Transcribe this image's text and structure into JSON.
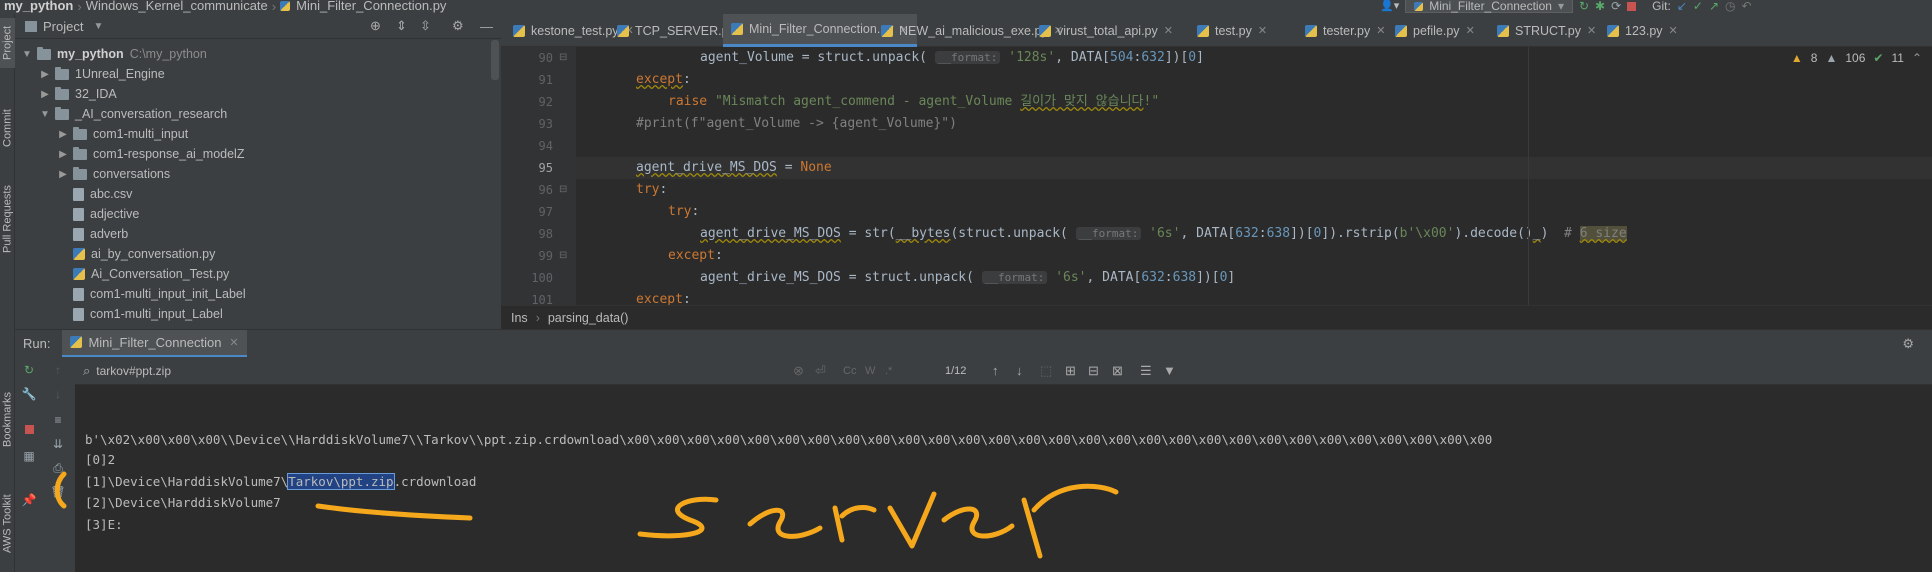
{
  "breadcrumb": {
    "project": "my_python",
    "folder": "Windows_Kernel_communicate",
    "file": "Mini_Filter_Connection.py"
  },
  "toolbar": {
    "run_config": "Mini_Filter_Connection",
    "git_label": "Git:"
  },
  "left_strip": [
    "Project",
    "Commit",
    "Pull Requests",
    "Bookmarks",
    "AWS Toolkit"
  ],
  "project_panel": {
    "title": "Project",
    "root_name": "my_python",
    "root_path": "C:\\my_python",
    "items": [
      {
        "label": "1Unreal_Engine",
        "type": "folder",
        "level": 1,
        "expanded": false
      },
      {
        "label": "32_IDA",
        "type": "folder",
        "level": 1,
        "expanded": false
      },
      {
        "label": "_AI_conversation_research",
        "type": "folder",
        "level": 1,
        "expanded": true
      },
      {
        "label": "com1-multi_input",
        "type": "folder",
        "level": 2,
        "expanded": false
      },
      {
        "label": "com1-response_ai_modelZ",
        "type": "folder",
        "level": 2,
        "expanded": false
      },
      {
        "label": "conversations",
        "type": "folder",
        "level": 2,
        "expanded": false
      },
      {
        "label": "abc.csv",
        "type": "file",
        "level": 2
      },
      {
        "label": "adjective",
        "type": "file",
        "level": 2
      },
      {
        "label": "adverb",
        "type": "file",
        "level": 2
      },
      {
        "label": "ai_by_conversation.py",
        "type": "py",
        "level": 2
      },
      {
        "label": "Ai_Conversation_Test.py",
        "type": "py",
        "level": 2
      },
      {
        "label": "com1-multi_input_init_Label",
        "type": "file",
        "level": 2
      },
      {
        "label": "com1-multi_input_Label",
        "type": "file",
        "level": 2
      }
    ]
  },
  "editor_tabs": [
    {
      "label": "kestone_test.py",
      "active": false
    },
    {
      "label": "TCP_SERVER.py",
      "active": false
    },
    {
      "label": "Mini_Filter_Connection.py",
      "active": true
    },
    {
      "label": "NEW_ai_malicious_exe.py",
      "active": false
    },
    {
      "label": "virust_total_api.py",
      "active": false
    },
    {
      "label": "test.py",
      "active": false
    },
    {
      "label": "tester.py",
      "active": false
    },
    {
      "label": "pefile.py",
      "active": false
    },
    {
      "label": "STRUCT.py",
      "active": false
    },
    {
      "label": "123.py",
      "active": false
    }
  ],
  "inspections": {
    "warnings": "8",
    "weak": "106",
    "ok": "11"
  },
  "line_numbers": [
    "90",
    "91",
    "92",
    "93",
    "94",
    "95",
    "96",
    "97",
    "98",
    "99",
    "100",
    "101"
  ],
  "code_lines": [
    "agent_Volume = struct.unpack( __format: '128s', DATA[504:632])[0]",
    "except:",
    "raise \"Mismatch agent_commend - agent_Volume 길이가 맞지 않습니다!\"",
    "#print(f\"agent_Volume -> {agent_Volume}\")",
    "",
    "agent_drive_MS_DOS = None",
    "try:",
    "try:",
    "agent_drive_MS_DOS = str(__bytes(struct.unpack( __format: '6s', DATA[632:638])[0]).rstrip(b'\\x00').decode()_)  # 6 size",
    "except:",
    "agent_drive_MS_DOS = struct.unpack( __format: '6s', DATA[632:638])[0]",
    "except:"
  ],
  "editor_breadcrumb": {
    "a": "Ins",
    "b": "parsing_data()"
  },
  "run_panel": {
    "label": "Run:",
    "tab": "Mini_Filter_Connection",
    "search_value": "tarkov#ppt.zip",
    "match_count": "1/12"
  },
  "console": {
    "line1": "b'\\x02\\x00\\x00\\x00\\\\Device\\\\HarddiskVolume7\\\\Tarkov\\\\ppt.zip.crdownload\\x00\\x00\\x00\\x00\\x00\\x00\\x00\\x00\\x00\\x00\\x00\\x00\\x00\\x00\\x00\\x00\\x00\\x00\\x00\\x00\\x00\\x00\\x00\\x00\\x00\\x00\\x00\\x00\\x00",
    "line2": "[0]2",
    "line3_pre": "[1]\\Device\\HarddiskVolume7\\",
    "line3_sel": "Tarkov\\ppt.zip",
    "line3_post": ".crdownload",
    "line4": "[2]\\Device\\HarddiskVolume7",
    "line5": "[3]E:"
  },
  "annotation": {
    "text": "server",
    "color": "#f5a81c"
  },
  "colors": {
    "accent": "#4a88c7",
    "selection": "#214283",
    "handwriting": "#f5a81c"
  }
}
